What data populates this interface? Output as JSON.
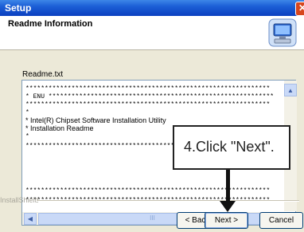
{
  "window": {
    "title": "Setup",
    "close_glyph": "✕"
  },
  "header": {
    "title": "Readme Information",
    "icon": "setup-computer-icon"
  },
  "panel": {
    "label": "Readme.txt"
  },
  "readme": {
    "lines": [
      {
        "text": "****************************************************************"
      },
      {
        "text": "* ENU ***********************************************************"
      },
      {
        "text": "****************************************************************"
      },
      {
        "text": "*"
      },
      {
        "text": "* Intel(R) Chipset Software Installation Utility"
      },
      {
        "text": "* Installation Readme"
      },
      {
        "text": "*"
      },
      {
        "text": "****************************************************************"
      },
      {
        "text": "****************************************************************"
      },
      {
        "text": "****************************************************************"
      }
    ]
  },
  "scroll": {
    "up": "▲",
    "left": "◀",
    "right": "▶",
    "thumb": "III"
  },
  "footer": {
    "brand": "InstallShield"
  },
  "buttons": {
    "back": "< Back",
    "next": "Next >",
    "cancel": "Cancel"
  },
  "callout": {
    "text": "4.Click \"Next\"."
  }
}
